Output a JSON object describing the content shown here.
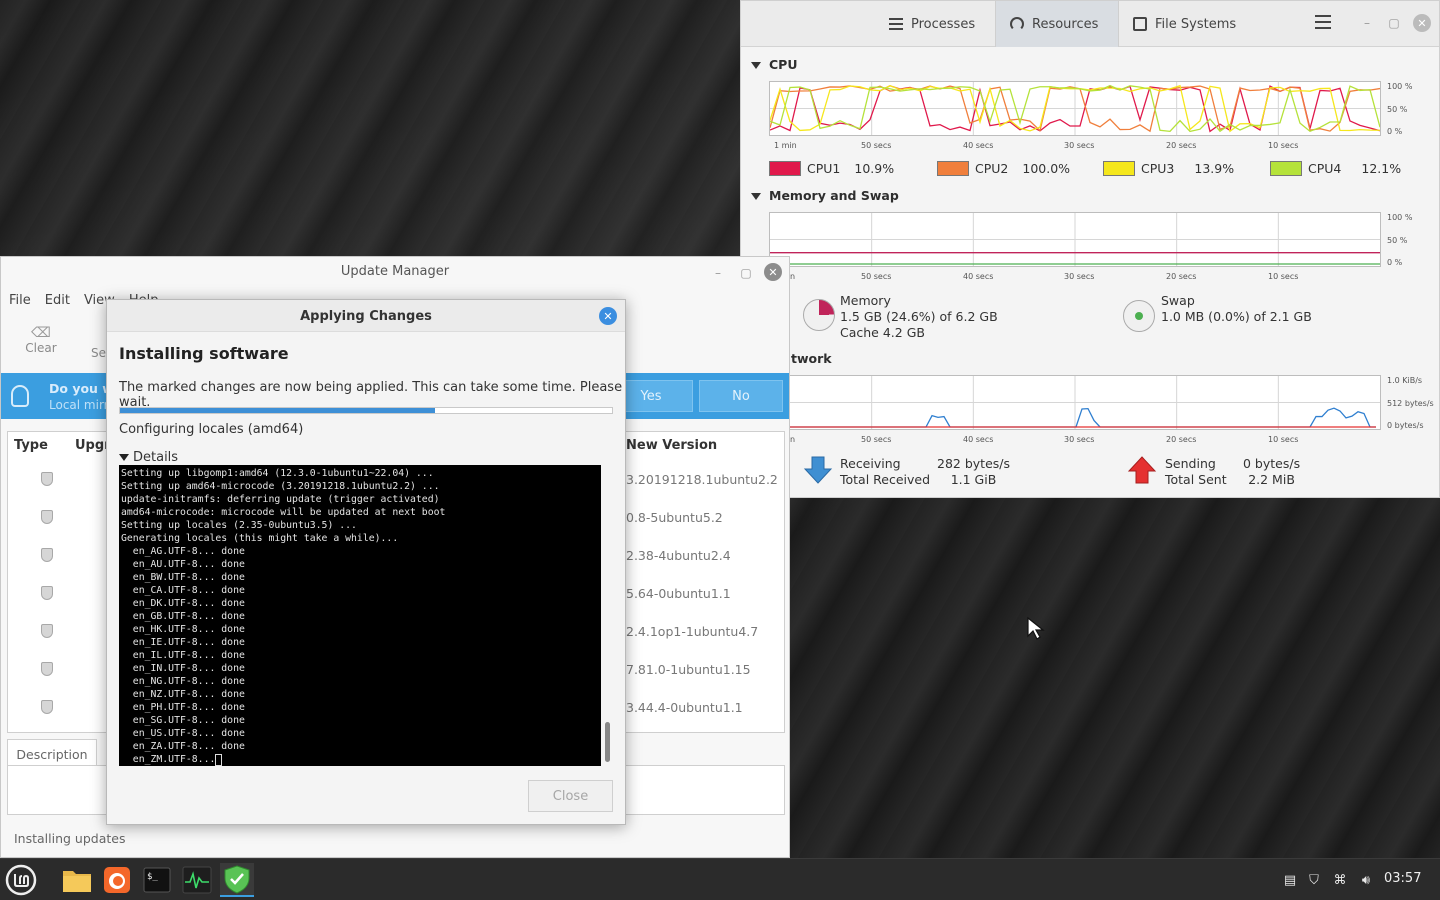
{
  "system_monitor": {
    "tabs": [
      {
        "label": "Processes",
        "icon": "list-icon"
      },
      {
        "label": "Resources",
        "icon": "gauge-icon",
        "active": true
      },
      {
        "label": "File Systems",
        "icon": "drive-icon"
      }
    ],
    "cpu": {
      "title": "CPU",
      "y_ticks": [
        "100 %",
        "50 %",
        "0 %"
      ],
      "x_ticks": [
        "1 min",
        "50 secs",
        "40 secs",
        "30 secs",
        "20 secs",
        "10 secs"
      ],
      "legend": [
        {
          "name": "CPU1",
          "value": "10.9%",
          "color": "#e0194b"
        },
        {
          "name": "CPU2",
          "value": "100.0%",
          "color": "#f07f3c"
        },
        {
          "name": "CPU3",
          "value": "13.9%",
          "color": "#f5e71c"
        },
        {
          "name": "CPU4",
          "value": "12.1%",
          "color": "#b5e23a"
        }
      ]
    },
    "memory": {
      "title": "Memory and Swap",
      "y_ticks": [
        "100 %",
        "50 %",
        "0 %"
      ],
      "x_ticks": [
        "50 secs",
        "40 secs",
        "30 secs",
        "20 secs",
        "10 secs"
      ],
      "x_partial_label": "n",
      "memory_label": "Memory",
      "memory_value": "1.5 GB (24.6%) of 6.2 GB",
      "cache_value": "Cache 4.2 GB",
      "memory_percent": 24.6,
      "swap_label": "Swap",
      "swap_value": "1.0 MB (0.0%) of 2.1 GB"
    },
    "network": {
      "title_partial": "twork",
      "y_ticks": [
        "1.0 KiB/s",
        "512 bytes/s",
        "0 bytes/s"
      ],
      "x_ticks": [
        "50 secs",
        "40 secs",
        "30 secs",
        "20 secs",
        "10 secs"
      ],
      "x_partial_label": "n",
      "receiving_label": "Receiving",
      "receiving_value": "282 bytes/s",
      "total_received_label": "Total Received",
      "total_received_value": "1.1 GiB",
      "sending_label": "Sending",
      "sending_value": "0 bytes/s",
      "total_sent_label": "Total Sent",
      "total_sent_value": "2.2 MiB"
    }
  },
  "update_manager": {
    "title": "Update Manager",
    "menu": [
      "File",
      "Edit",
      "View",
      "Help"
    ],
    "toolbar": {
      "clear_label": "Clear",
      "select_label": "Se"
    },
    "banner": {
      "line1": "Do you w",
      "line2": "Local mirr",
      "yes_label": "Yes",
      "no_label": "No"
    },
    "columns": {
      "type": "Type",
      "upgrade": "Upgra",
      "new_version": "New Version"
    },
    "rows": [
      {
        "version": "3.20191218.1ubuntu2.2"
      },
      {
        "version": "0.8-5ubuntu5.2"
      },
      {
        "version": "2.38-4ubuntu2.4"
      },
      {
        "version": "5.64-0ubuntu1.1"
      },
      {
        "version": "2.4.1op1-1ubuntu4.7"
      },
      {
        "version": "7.81.0-1ubuntu1.15"
      },
      {
        "version": "3.44.4-0ubuntu1.1"
      }
    ],
    "description_tab": "Description",
    "status": "Installing updates"
  },
  "dialog": {
    "title": "Applying Changes",
    "heading": "Installing software",
    "message": "The marked changes are now being applied. This can take some time. Please wait.",
    "progress": 0.64,
    "step": "Configuring locales (amd64)",
    "details_label": "Details",
    "terminal_lines": [
      "Setting up libgomp1:amd64 (12.3.0-1ubuntu1~22.04) ...",
      "Setting up amd64-microcode (3.20191218.1ubuntu2.2) ...",
      "update-initramfs: deferring update (trigger activated)",
      "amd64-microcode: microcode will be updated at next boot",
      "Setting up locales (2.35-0ubuntu3.5) ...",
      "Generating locales (this might take a while)...",
      "  en_AG.UTF-8... done",
      "  en_AU.UTF-8... done",
      "  en_BW.UTF-8... done",
      "  en_CA.UTF-8... done",
      "  en_DK.UTF-8... done",
      "  en_GB.UTF-8... done",
      "  en_HK.UTF-8... done",
      "  en_IE.UTF-8... done",
      "  en_IL.UTF-8... done",
      "  en_IN.UTF-8... done",
      "  en_NG.UTF-8... done",
      "  en_NZ.UTF-8... done",
      "  en_PH.UTF-8... done",
      "  en_SG.UTF-8... done",
      "  en_US.UTF-8... done",
      "  en_ZA.UTF-8... done"
    ],
    "terminal_last_line": "  en_ZM.UTF-8...",
    "close_label": "Close"
  },
  "taskbar": {
    "clock": "03:57",
    "accent": "#3b9ee0"
  }
}
